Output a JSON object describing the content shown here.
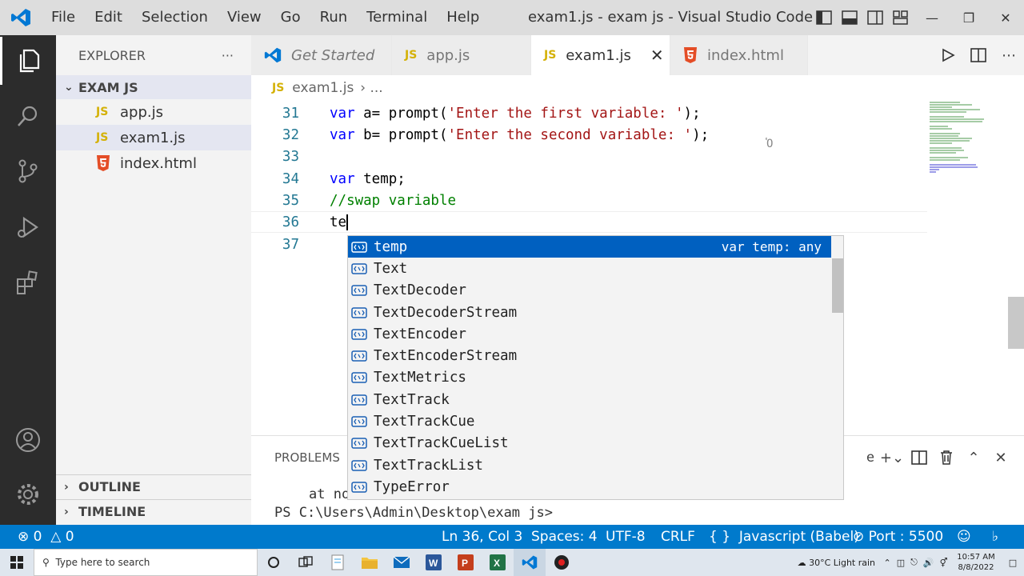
{
  "titlebar": {
    "menus": [
      "File",
      "Edit",
      "Selection",
      "View",
      "Go",
      "Run",
      "Terminal",
      "Help"
    ],
    "title": "exam1.js - exam js - Visual Studio Code"
  },
  "sidebar": {
    "header": "EXPLORER",
    "more": "···",
    "folder": "EXAM JS",
    "files": [
      {
        "name": "app.js",
        "icon": "js"
      },
      {
        "name": "exam1.js",
        "icon": "js"
      },
      {
        "name": "index.html",
        "icon": "html5"
      }
    ],
    "outline": "OUTLINE",
    "timeline": "TIMELINE"
  },
  "tabs": [
    {
      "label": "Get Started"
    },
    {
      "label": "app.js"
    },
    {
      "label": "exam1.js"
    },
    {
      "label": "index.html"
    }
  ],
  "breadcrumb": {
    "file": "exam1.js",
    "sep": "› ..."
  },
  "editor": {
    "lines": [
      {
        "num": "31",
        "kw": "var",
        "rest": " a= prompt(",
        "str": "'Enter the first variable: '",
        "end": ");"
      },
      {
        "num": "32",
        "kw": "var",
        "rest": " b= prompt(",
        "str": "'Enter the second variable: '",
        "end": ");"
      },
      {
        "num": "33"
      },
      {
        "num": "34",
        "kw": "var",
        "rest": " temp;"
      },
      {
        "num": "35",
        "comment": "//swap variable"
      },
      {
        "num": "36",
        "typed": "te"
      },
      {
        "num": "37"
      }
    ]
  },
  "suggest": {
    "items": [
      "temp",
      "Text",
      "TextDecoder",
      "TextDecoderStream",
      "TextEncoder",
      "TextEncoderStream",
      "TextMetrics",
      "TextTrack",
      "TextTrackCue",
      "TextTrackCueList",
      "TextTrackList",
      "TypeError"
    ],
    "selected_detail": "var temp: any"
  },
  "panel": {
    "tab": "PROBLEMS",
    "partial": "e",
    "term_line1": "at no",
    "term_line2": "PS C:\\Users\\Admin\\Desktop\\exam js>"
  },
  "statusbar": {
    "errors": "0",
    "warnings": "0",
    "position": "Ln 36, Col 3",
    "spaces": "Spaces: 4",
    "encoding": "UTF-8",
    "eol": "CRLF",
    "language": "Javascript (Babel)",
    "port": "Port : 5500"
  },
  "taskbar": {
    "search_placeholder": "Type here to search",
    "weather": "30°C  Light rain",
    "time": "10:57 AM",
    "date": "8/8/2022"
  },
  "colors": {
    "accent": "#007acc",
    "selection": "#0060c0",
    "activity_bar": "#2c2c2c"
  }
}
